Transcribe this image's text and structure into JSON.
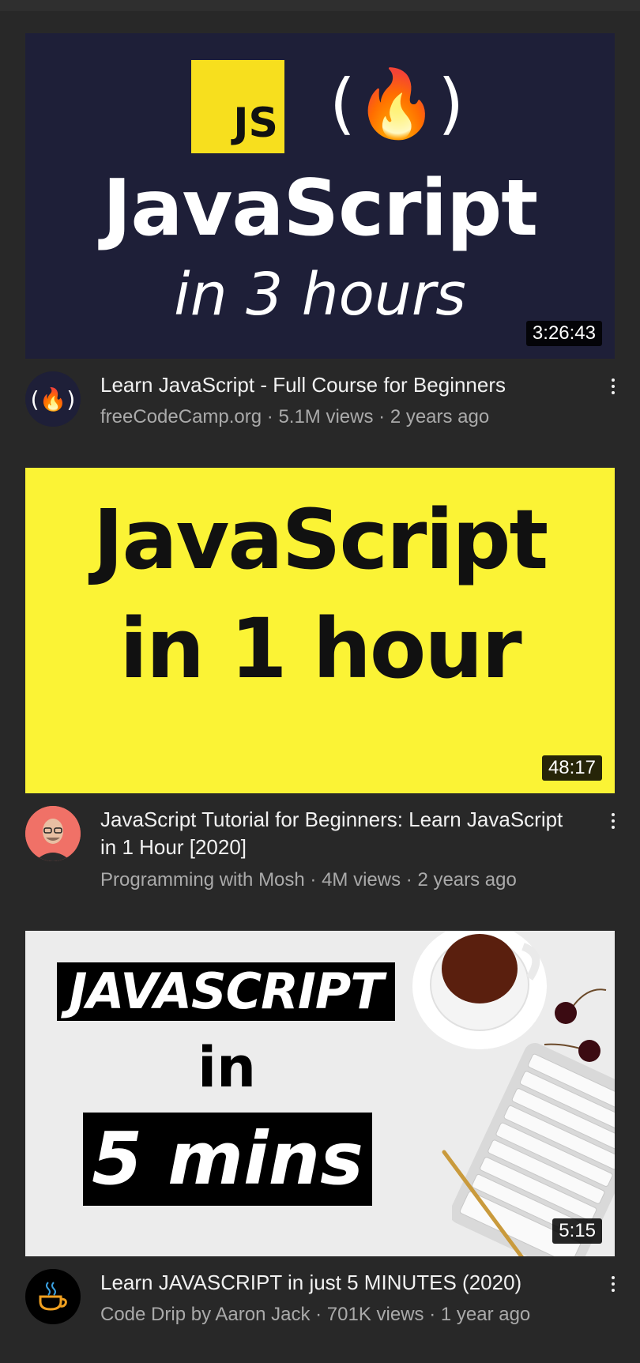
{
  "videos": [
    {
      "thumbnail": {
        "badge": "JS",
        "brand_glyph": "(🔥)",
        "line1": "JavaScript",
        "line2": "in 3 hours"
      },
      "duration": "3:26:43",
      "title": "Learn JavaScript - Full Course for Beginners",
      "channel": "freeCodeCamp.org",
      "views": "5.1M views",
      "age": "2 years ago",
      "avatar_glyph": "(🔥)"
    },
    {
      "thumbnail": {
        "line1": "JavaScript",
        "line2": "in 1 hour"
      },
      "duration": "48:17",
      "title": "JavaScript Tutorial for Beginners: Learn JavaScript in 1 Hour [2020]",
      "channel": "Programming with Mosh",
      "views": "4M views",
      "age": "2 years ago"
    },
    {
      "thumbnail": {
        "line1": "JAVASCRIPT",
        "line2": "in",
        "line3": "5 mins"
      },
      "duration": "5:15",
      "title": "Learn JAVASCRIPT in just 5 MINUTES (2020)",
      "channel": "Code Drip by Aaron Jack",
      "views": "701K views",
      "age": "1 year ago"
    }
  ],
  "separator": " · ",
  "colors": {
    "background": "#282828",
    "primary_text": "#f1f1f1",
    "secondary_text": "#aaaaaa",
    "js_yellow": "#f7df1e"
  }
}
